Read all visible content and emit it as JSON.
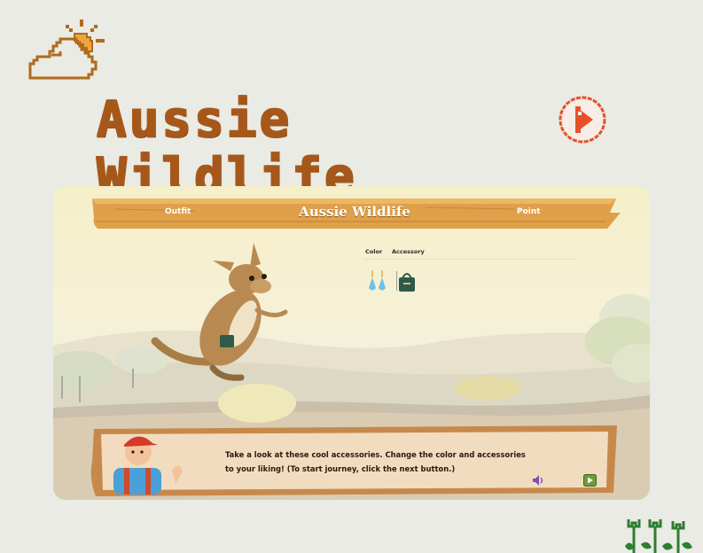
{
  "page": {
    "title": "Aussie Wildlife"
  },
  "game": {
    "banner_title": "Aussie Wildlife",
    "tabs": [
      {
        "label": "Outfit"
      },
      {
        "label": "Point"
      }
    ],
    "accessory_panel": {
      "headers": [
        {
          "label": "Color"
        },
        {
          "label": "Accessory"
        }
      ],
      "items": [
        {
          "icon": "earrings-icon",
          "kind": "color"
        },
        {
          "icon": "handbag-icon",
          "kind": "accessory"
        }
      ]
    },
    "dialog": {
      "text": "Take a look at these cool accessories. Change the color and accessories to your liking! (To start journey, click the next button.)"
    }
  },
  "colors": {
    "title": "#a6581a",
    "background": "#e9ebe4",
    "wood": "#e0a04a",
    "wood_dark": "#b8742a",
    "play_icon": "#e8502a",
    "next_button": "#6e9b3a"
  },
  "icons": {
    "weather": "cloud-sun-icon",
    "audio": "play-audio-icon",
    "speaker": "speaker-icon",
    "next": "next-play-icon",
    "decoration": "tulip-icon"
  }
}
